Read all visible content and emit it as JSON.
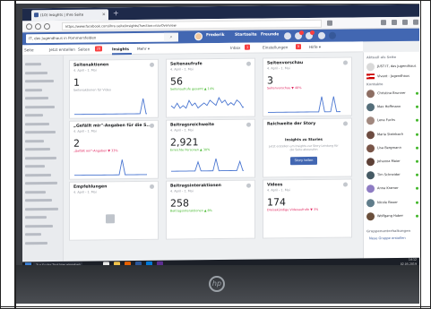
{
  "browser": {
    "tab_title": "(10) Insights | Ihre Seite",
    "tab_close": "×",
    "new_tab": "+",
    "url": "https://www.facebook.com/ihre-seite/insights/?section=navOverview"
  },
  "facebook": {
    "search_value": "IT, das Jugendhaus in Pommersfelden",
    "search_icon": "magnifier",
    "nav": [
      "Frederik",
      "Startseite",
      "Freunde"
    ]
  },
  "page_tabs": {
    "items": [
      {
        "label": "Seite"
      },
      {
        "label": "Jetzt erstellen"
      },
      {
        "label": "Seiten",
        "badge": "20"
      },
      {
        "label": "Insights",
        "active": true
      },
      {
        "label": "Mehr ▾"
      },
      {
        "label": "Inbox",
        "badge": "1"
      },
      {
        "label": "Einstellungen",
        "badge": "9"
      },
      {
        "label": "Hilfe ▾"
      }
    ]
  },
  "cards": [
    {
      "title": "Seitenaktionen",
      "sub": "4. April - 1. Mai",
      "value": "1",
      "change": "Seitenaktionen für Video",
      "trend": "neutral",
      "spark": [
        0,
        0,
        0,
        0,
        0,
        0,
        0,
        0,
        0,
        0,
        0,
        0,
        0,
        0,
        0,
        0,
        0,
        0,
        0,
        0,
        0,
        0,
        0,
        1,
        0,
        0,
        0,
        0
      ]
    },
    {
      "title": "Seitenaufrufe",
      "sub": "4. April - 1. Mai",
      "value": "56",
      "change": "Seitenaufrufe gesamt ▲ 14%",
      "trend": "up",
      "spark": [
        3,
        2,
        4,
        2,
        3,
        2,
        5,
        3,
        4,
        2,
        3,
        4,
        3,
        5,
        4,
        3,
        6,
        4,
        5,
        3,
        4,
        3,
        5,
        4,
        2,
        3,
        2,
        3
      ]
    },
    {
      "title": "Seitenvorschau",
      "sub": "4. April - 1. Mai",
      "value": "3",
      "change": "Seitenvorschau ▼ 40%",
      "trend": "down",
      "spark": [
        0,
        0,
        0,
        0,
        0,
        0,
        0,
        0,
        0,
        0,
        0,
        0,
        0,
        0,
        0,
        0,
        0,
        0,
        1,
        0,
        0,
        0,
        1,
        0,
        0,
        0,
        0,
        0
      ]
    },
    {
      "title": "„Gefällt mir\"-Angaben für die S...",
      "sub": "4. April - 1. Mai",
      "value": "2",
      "change": "„Gefällt mir\"-Angaben ▼ 33%",
      "trend": "down",
      "spark": [
        0,
        0,
        0,
        0,
        0,
        0,
        0,
        0,
        0,
        0,
        0,
        0,
        0,
        0,
        0,
        0,
        1,
        0,
        0,
        0,
        0,
        0,
        0,
        0,
        0,
        0,
        0,
        0
      ]
    },
    {
      "title": "Beitragsreichweite",
      "sub": "4. April - 1. Mai",
      "value": "2,921",
      "change": "Erreichte Personen ▲ 30%",
      "trend": "up",
      "spark": [
        1,
        1,
        1,
        1,
        1,
        1,
        1,
        1,
        1,
        4,
        1,
        1,
        1,
        1,
        1,
        5,
        1,
        1,
        1,
        1,
        1,
        1,
        1,
        4,
        1,
        1,
        1,
        1
      ]
    },
    {
      "title": "Reichweite der Story",
      "sub": "",
      "value": "",
      "change": "",
      "trend": "story"
    },
    {
      "title": "Empfehlungen",
      "sub": "4. April - 1. Mai",
      "value": "",
      "change": "",
      "trend": "placeholder"
    },
    {
      "title": "Beitragsinteraktionen",
      "sub": "4. April - 1. Mai",
      "value": "258",
      "change": "Beitragsinteraktionen ▲ 8%",
      "trend": "up",
      "spark": []
    },
    {
      "title": "Videos",
      "sub": "4. April - 1. Mai",
      "value": "174",
      "change": "Dreisekündige Videoaufrufe ▼ 3%",
      "trend": "down",
      "spark": []
    }
  ],
  "story": {
    "heading": "Insights zu Stories",
    "text": "Jetzt erstellen um Insights zur Story-Leistung für die Seite abzurufen",
    "button": "Story teilen"
  },
  "right_sidebar": {
    "head1": "Aktuell als Seite",
    "pages": [
      {
        "name": "JUST IT, das Jugendhaus",
        "flag": false
      },
      {
        "name": "Vivant - Jugendhaus",
        "flag": true
      }
    ],
    "head2": "Kontakte",
    "contacts": [
      {
        "name": "Christina Brunner",
        "color": "#8d6e63"
      },
      {
        "name": "Max Hoffmann",
        "color": "#546e7a"
      },
      {
        "name": "Lena Fuchs",
        "color": "#a1887f"
      },
      {
        "name": "Maria Steinbach",
        "color": "#6d4c41"
      },
      {
        "name": "Lisa Bergmann",
        "color": "#795548"
      },
      {
        "name": "Johanna Maier",
        "color": "#5d4037"
      },
      {
        "name": "Tim Schneider",
        "color": "#455a64"
      },
      {
        "name": "Anna Kramer",
        "color": "#8e7cc3"
      },
      {
        "name": "Nicole Bauer",
        "color": "#607d8b"
      },
      {
        "name": "Wolfgang Huber",
        "color": "#6a4f3b"
      }
    ],
    "head3": "Gruppenunterhaltungen",
    "group_link": "Neue Gruppe erstellen"
  },
  "taskbar": {
    "search_placeholder": "Zur Suche Text hier eingeben",
    "time": "14:12",
    "date": "02.05.2019"
  },
  "monitor": {
    "brand": "hp"
  },
  "colors": {
    "fb_blue": "#4267b2",
    "spark_blue": "#4a76d1",
    "badge_red": "#fa3e3e"
  }
}
